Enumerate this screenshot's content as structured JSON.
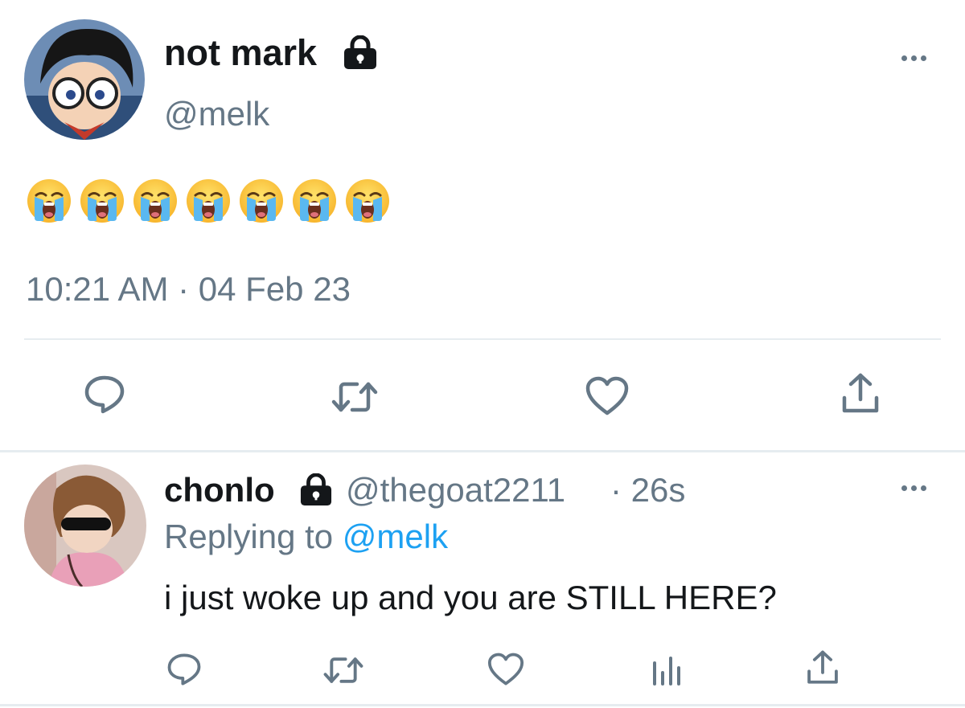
{
  "main_tweet": {
    "display_name": "not mark",
    "handle": "@melk",
    "emoji_count": 7,
    "emoji_name": "loudly-crying-face",
    "timestamp": "10:21 AM · 04 Feb 23",
    "actions": [
      "reply-icon",
      "retweet-icon",
      "like-icon",
      "share-icon"
    ]
  },
  "reply": {
    "display_name": "chonlo",
    "handle": "@thegoat2211",
    "time": "· 26s",
    "replying_prefix": "Replying to",
    "replying_handle": "@melk",
    "text": "i just woke up and you are STILL HERE?",
    "actions": [
      "reply-icon",
      "retweet-icon",
      "like-icon",
      "analytics-icon",
      "share-icon"
    ]
  },
  "colors": {
    "text": "#14171a",
    "muted": "#657786",
    "link": "#1da1f2",
    "divider": "#e6ecf0"
  }
}
